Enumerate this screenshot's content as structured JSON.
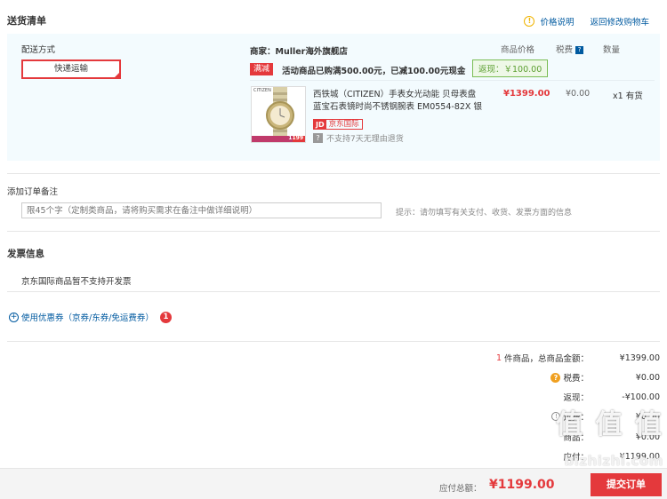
{
  "header": {
    "title": "送货清单",
    "price_note": "价格说明",
    "back_to_cart": "返回修改购物车"
  },
  "shipping": {
    "label": "配送方式",
    "method": "快递运输"
  },
  "shop": {
    "name": "商家：Muller海外旗舰店",
    "col_price": "商品价格",
    "col_tax": "税费",
    "col_qty": "数量",
    "promo_tag": "满减",
    "promo_text": "活动商品已购满500.00元，已减100.00元现金",
    "rebate": "返现：￥100.00"
  },
  "product": {
    "title": "西铁城（CITIZEN）手表女光动能 贝母表盘蓝宝石表镜时尚不锈钢腕表 EM0554-82X 银",
    "brand_on_image": "CITIZEN",
    "image_price": "1199",
    "price": "¥1399.00",
    "tax": "¥0.00",
    "qty": "x1",
    "stock": "有货",
    "badge_logo": "JD",
    "badge_text": "京东国际",
    "return_policy": "不支持7天无理由退货"
  },
  "remark": {
    "label": "添加订单备注",
    "placeholder": "限45个字（定制类商品，请将购买需求在备注中做详细说明）",
    "hint": "提示：请勿填写有关支付、收货、发票方面的信息"
  },
  "invoice": {
    "title": "发票信息",
    "text": "京东国际商品暂不支持开发票"
  },
  "coupon": {
    "label": "使用优惠券（京券/东券/免运费券）",
    "count": "1"
  },
  "summary": {
    "items_count": "1",
    "items_label": "件商品，总商品金额：",
    "items_total": "¥1399.00",
    "tax_label": "税费：",
    "tax_value": "¥0.00",
    "rebate_label": "返现：",
    "rebate_value": "-¥100.00",
    "shipping_label": "运费：",
    "shipping_value": "¥0.00",
    "row5_label": "商品：",
    "row5_value": "¥0.00",
    "row6_label": "应付：",
    "row6_value": "¥1199.00"
  },
  "footer": {
    "total_label": "应付总额：",
    "total_value": "¥1199.00",
    "submit": "提交订单"
  },
  "watermark": {
    "logo": "值 值 值",
    "text": "bizhizhi.com"
  },
  "colors": {
    "accent": "#e4393c",
    "link": "#005aa0",
    "panel_bg": "#f3fbfe"
  }
}
